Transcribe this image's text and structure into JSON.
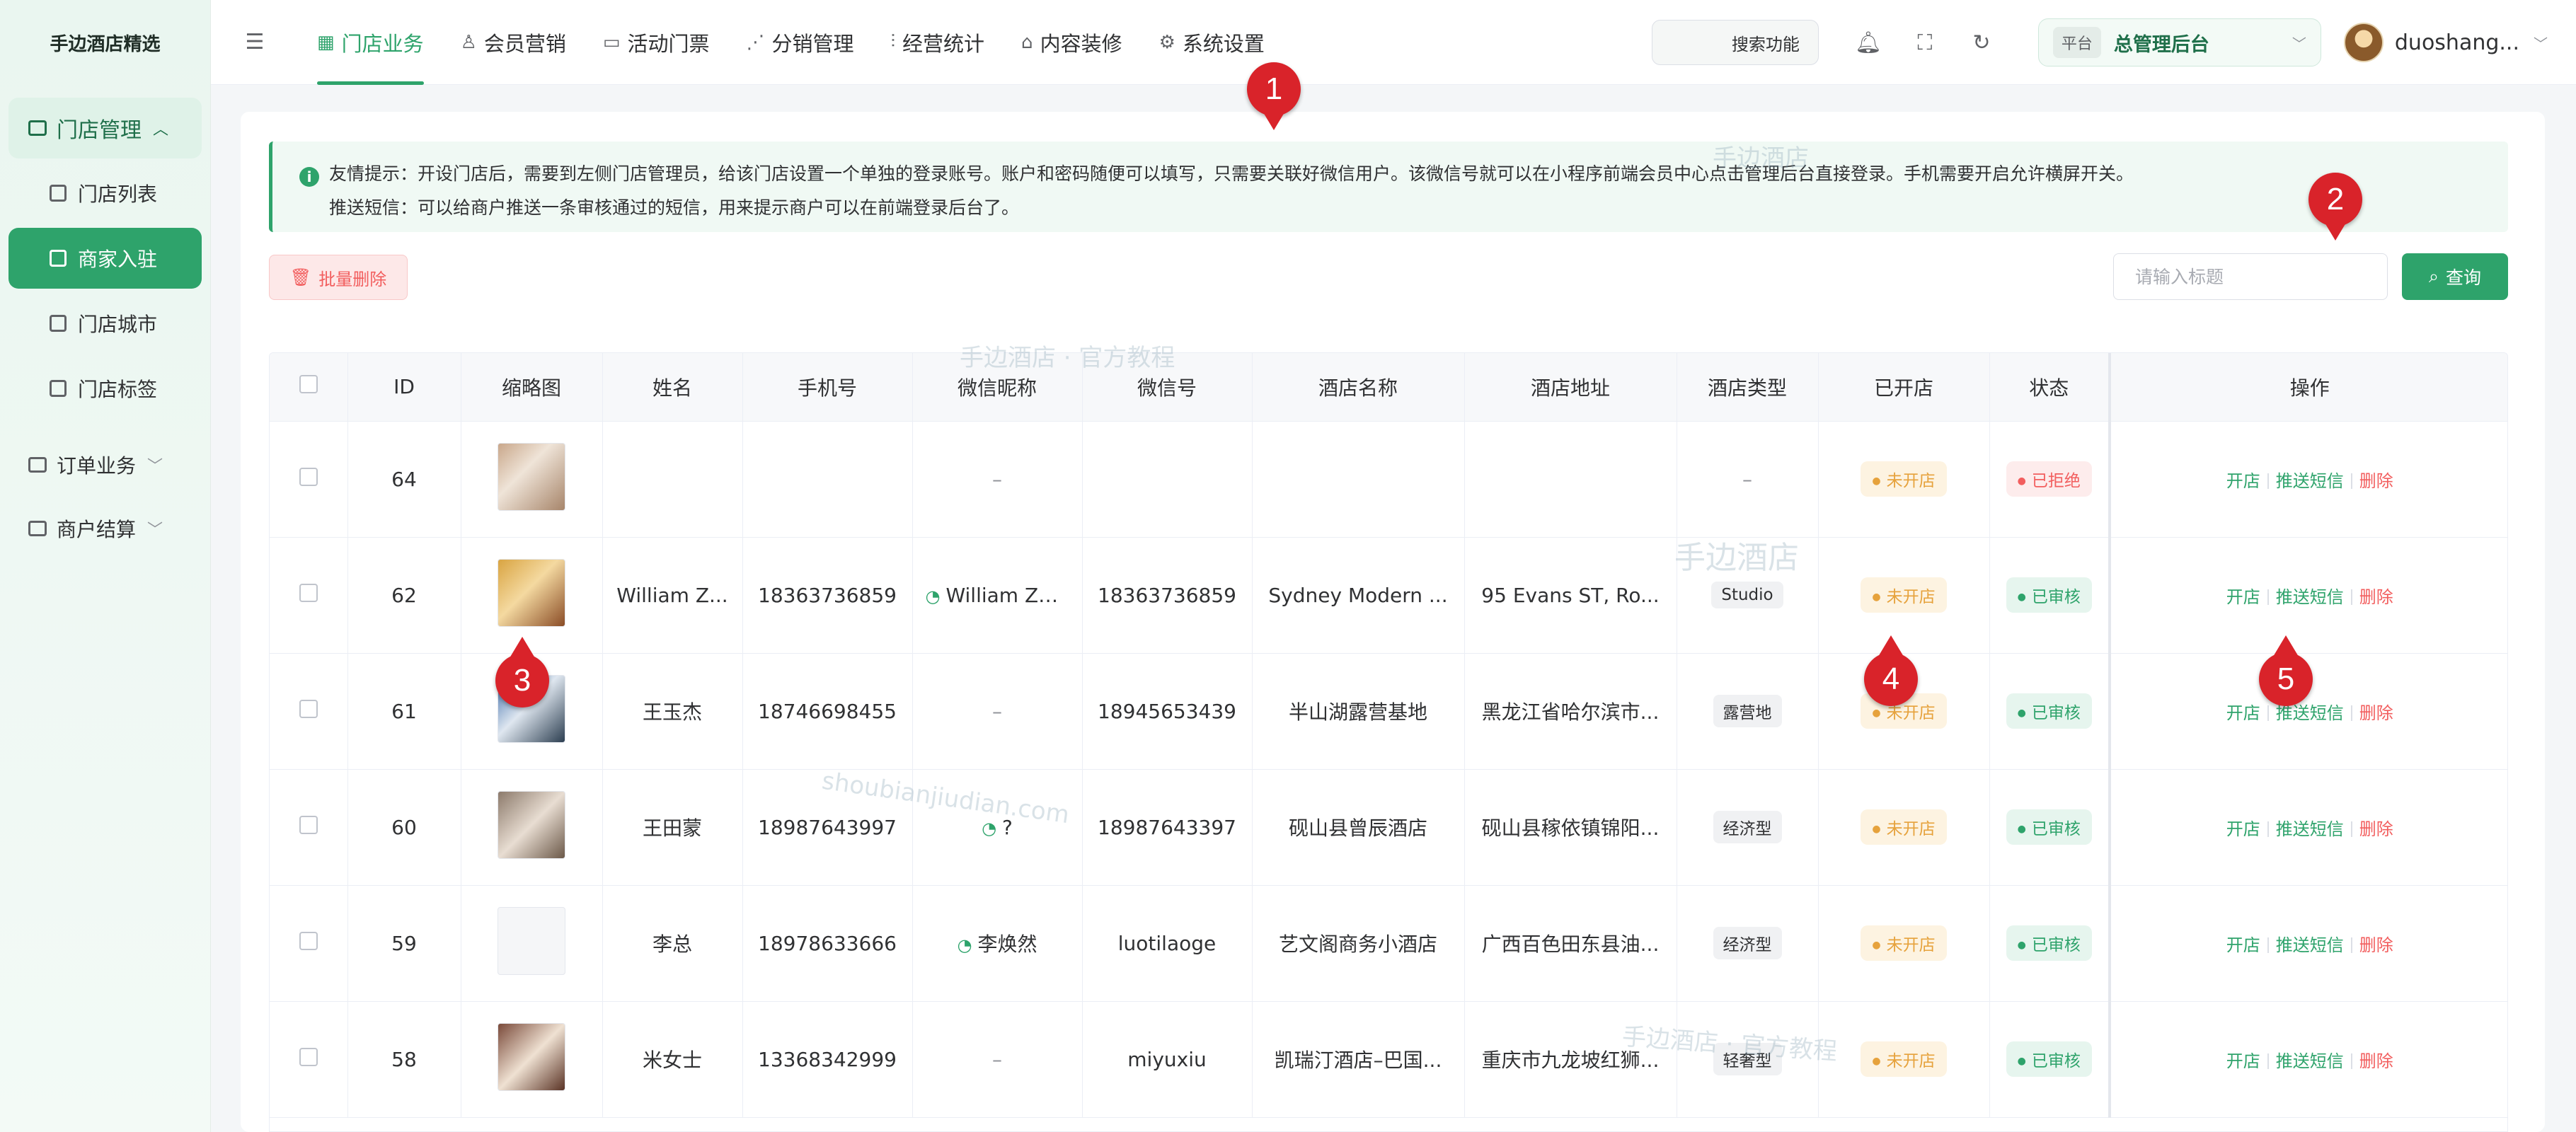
{
  "sidebar": {
    "brand": "手边酒店精选",
    "group_store": "门店管理",
    "items": [
      {
        "label": "门店列表"
      },
      {
        "label": "商家入驻"
      },
      {
        "label": "门店城市"
      },
      {
        "label": "门店标签"
      }
    ],
    "group_order": "订单业务",
    "group_settle": "商户结算"
  },
  "topnav": {
    "items": [
      {
        "label": "门店业务"
      },
      {
        "label": "会员营销"
      },
      {
        "label": "活动门票"
      },
      {
        "label": "分销管理"
      },
      {
        "label": "经营统计"
      },
      {
        "label": "内容装修"
      },
      {
        "label": "系统设置"
      }
    ],
    "search_label": "搜索功能",
    "platform_tag": "平台",
    "platform_value": "总管理后台",
    "username": "duoshang..."
  },
  "notice": {
    "line1": "友情提示：开设门店后，需要到左侧门店管理员，给该门店设置一个单独的登录账号。账户和密码随便可以填写，只需要关联好微信用户。该微信号就可以在小程序前端会员中心点击管理后台直接登录。手机需要开启允许横屏开关。",
    "line2": "推送短信：可以给商户推送一条审核通过的短信，用来提示商户可以在前端登录后台了。"
  },
  "toolbar": {
    "batch_delete": "批量删除",
    "title_placeholder": "请输入标题",
    "query": "查询"
  },
  "table": {
    "headers": [
      "ID",
      "缩略图",
      "姓名",
      "手机号",
      "微信昵称",
      "微信号",
      "酒店名称",
      "酒店地址",
      "酒店类型",
      "已开店",
      "状态",
      "操作"
    ],
    "rows": [
      {
        "id": "64",
        "name": "",
        "phone": "",
        "wx_nick": "–",
        "wx_id": "",
        "hotel": "",
        "address": "",
        "type": "–",
        "opened": "未开店",
        "status": "已拒绝"
      },
      {
        "id": "62",
        "name": "William Z...",
        "phone": "18363736859",
        "wx_nick": "William Zhao.",
        "wx_id": "18363736859",
        "hotel": "Sydney Modern ...",
        "address": "95 Evans ST, Ro...",
        "type": "Studio",
        "opened": "未开店",
        "status": "已审核"
      },
      {
        "id": "61",
        "name": "王玉杰",
        "phone": "18746698455",
        "wx_nick": "–",
        "wx_id": "18945653439",
        "hotel": "半山湖露营基地",
        "address": "黑龙江省哈尔滨市...",
        "type": "露营地",
        "opened": "未开店",
        "status": "已审核"
      },
      {
        "id": "60",
        "name": "王田蒙",
        "phone": "18987643997",
        "wx_nick": "?",
        "wx_id": "18987643397",
        "hotel": "砚山县曾辰酒店",
        "address": "砚山县稼依镇锦阳...",
        "type": "经济型",
        "opened": "未开店",
        "status": "已审核"
      },
      {
        "id": "59",
        "name": "李总",
        "phone": "18978633666",
        "wx_nick": "李焕然",
        "wx_id": "luotilaoge",
        "hotel": "艺文阁商务小酒店",
        "address": "广西百色田东县油...",
        "type": "经济型",
        "opened": "未开店",
        "status": "已审核"
      },
      {
        "id": "58",
        "name": "米女士",
        "phone": "13368342999",
        "wx_nick": "–",
        "wx_id": "miyuxiu",
        "hotel": "凯瑞汀酒店–巴国...",
        "address": "重庆市九龙坡红狮...",
        "type": "轻奢型",
        "opened": "未开店",
        "status": "已审核"
      }
    ],
    "op_open": "开店",
    "op_sms": "推送短信",
    "op_delete": "删除"
  },
  "markers": [
    "1",
    "2",
    "3",
    "4",
    "5"
  ],
  "watermarks": {
    "brand": "手边酒店",
    "tutorial": "手边酒店 · 官方教程",
    "domain": "shoubianjiudian.com"
  },
  "colors": {
    "accent": "#2ea36b",
    "danger": "#f25e5e",
    "warning": "#e6a23c",
    "marker": "#d9232a"
  }
}
